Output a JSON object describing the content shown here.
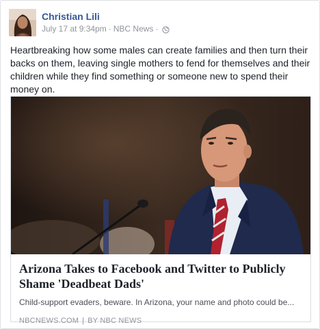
{
  "post": {
    "author": "Christian Lili",
    "date": "July 17 at 9:34pm",
    "via": "NBC News",
    "separator": "·",
    "privacy_icon": "globe-icon",
    "text": "Heartbreaking how some males can create families and then turn their backs on them, leaving single mothers to fend for themselves and their children while they find something or someone new to spend their money on."
  },
  "link": {
    "image_icon": "news-photo",
    "title": "Arizona Takes to Facebook and Twitter to Publicly Shame 'Deadbeat Dads'",
    "description": "Child-support evaders, beware. In Arizona, your name and photo could be...",
    "domain": "NBCNEWS.COM",
    "pipe": "|",
    "byline": "BY NBC NEWS"
  },
  "colors": {
    "name_link": "#365899",
    "meta_gray": "#90949c",
    "text": "#1d2129"
  }
}
